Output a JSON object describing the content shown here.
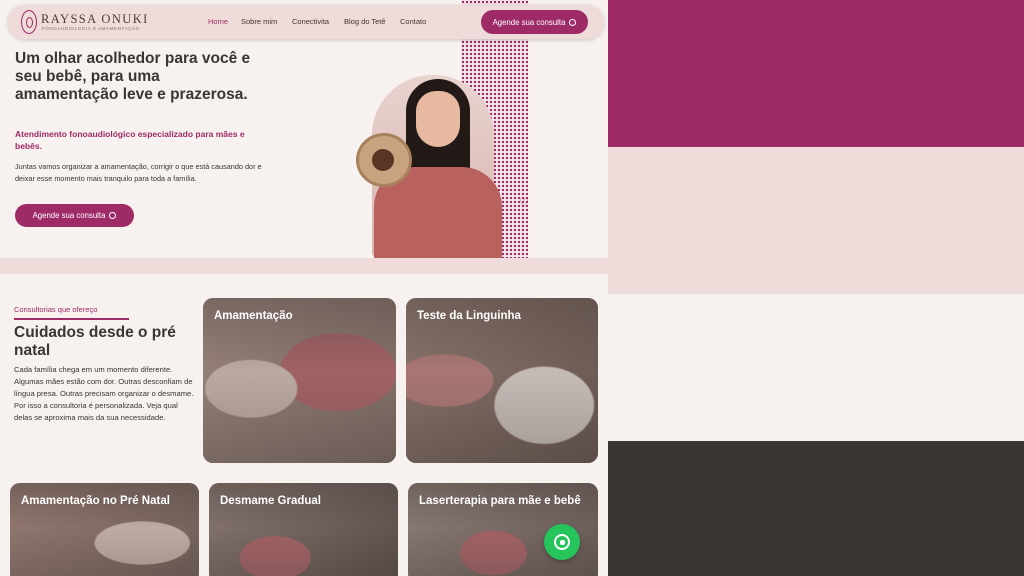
{
  "brand": {
    "name": "RAYSSA ONUKI",
    "tagline": "FONOAUDIOLOGIA E AMAMENTAÇÃO"
  },
  "nav": {
    "items": [
      "Home",
      "Sobre mim",
      "Conectivita",
      "Blog do Tetê",
      "Contato"
    ],
    "active": "Home",
    "cta": "Agende sua consulta"
  },
  "hero": {
    "title": "Um olhar acolhedor para você e seu bebê, para uma amamentação leve e prazerosa.",
    "subtitle": "Atendimento fonoaudiológico especializado para mães e bebês.",
    "body": "Juntas vamos organizar a amamentação, corrigir o que está causando dor e deixar esse momento mais tranquilo para toda a família.",
    "cta": "Agende sua consulta"
  },
  "services": {
    "label": "Consultorias que ofereço",
    "title": "Cuidados desde o pré natal",
    "body": "Cada família chega em um momento diferente. Algumas mães estão com dor. Outras desconfiam de língua presa. Outras precisam organizar o desmame. Por isso a consultoria é personalizada. Veja qual delas se aproxima mais da sua necessidade.",
    "cards": [
      "Amamentação",
      "Teste da Linguinha",
      "Amamentação no Pré Natal",
      "Desmame Gradual",
      "Laserterapia para mãe e bebê"
    ]
  },
  "colors": {
    "primary": "#9e2b66",
    "blush": "#efdcda",
    "cream": "#f7f1ef",
    "dark": "#3b3633",
    "whatsapp": "#25c55b"
  },
  "icons": {
    "whatsapp": "whatsapp-icon",
    "heart": "heart-icon"
  }
}
